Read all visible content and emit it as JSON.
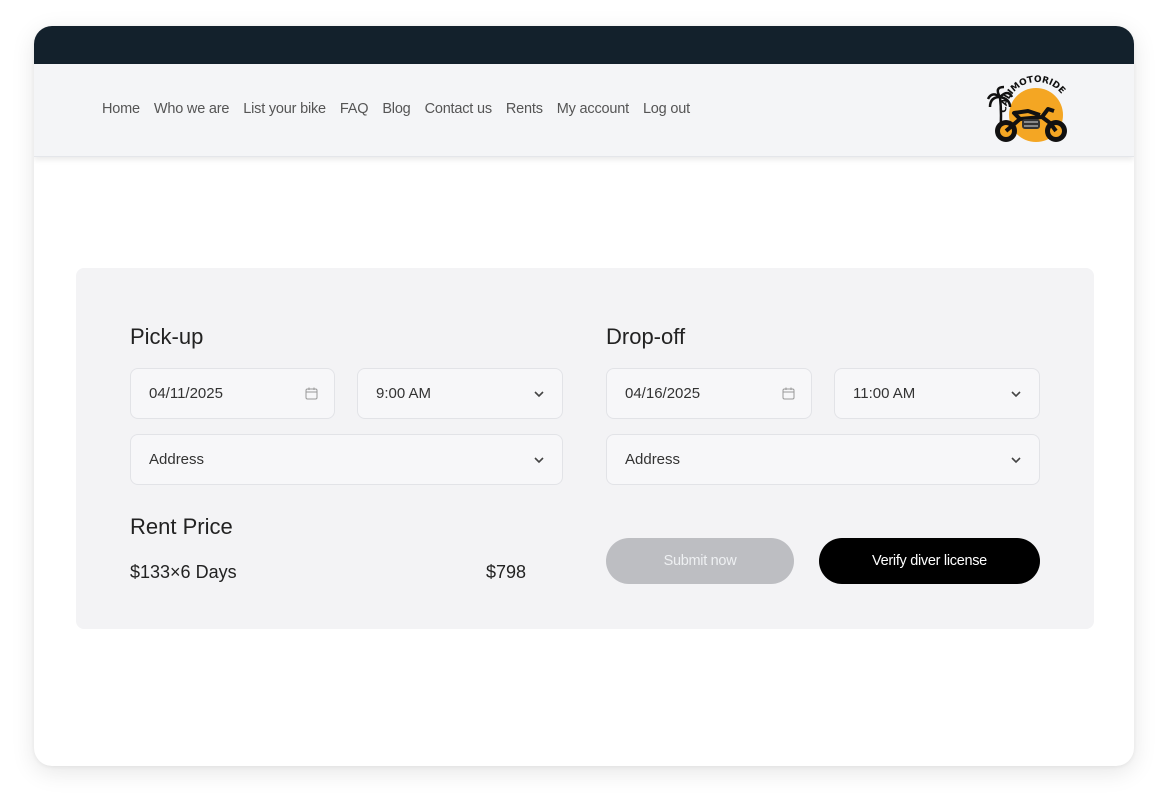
{
  "nav": {
    "links": [
      "Home",
      "Who we are",
      "List your bike",
      "FAQ",
      "Blog",
      "Contact us",
      "Rents",
      "My account",
      "Log out"
    ],
    "logo_text": "CALIMOTORIDE"
  },
  "pickup": {
    "title": "Pick-up",
    "date": "04/11/2025",
    "time": "9:00 AM",
    "address_placeholder": "Address"
  },
  "dropoff": {
    "title": "Drop-off",
    "date": "04/16/2025",
    "time": "11:00 AM",
    "address_placeholder": "Address"
  },
  "rent": {
    "title": "Rent Price",
    "breakdown": "$133×6 Days",
    "total": "$798"
  },
  "buttons": {
    "submit": "Submit now",
    "verify": "Verify diver license"
  },
  "colors": {
    "topbar": "#13212c",
    "logo_sun": "#f4a623",
    "submit_disabled": "#bdbec2",
    "verify": "#000000"
  }
}
